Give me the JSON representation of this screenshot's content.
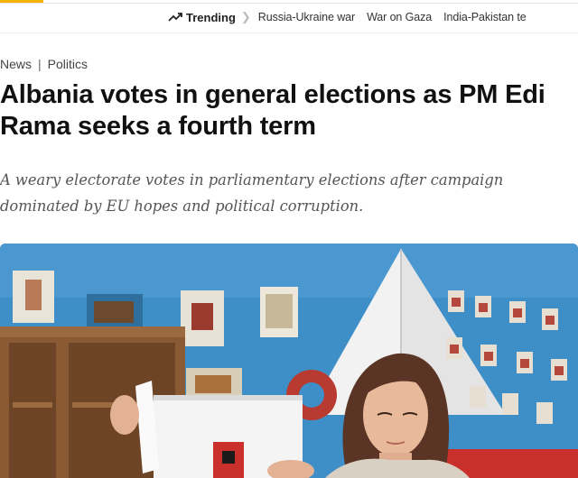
{
  "trending": {
    "label": "Trending",
    "links": [
      "Russia-Ukraine war",
      "War on Gaza",
      "India-Pakistan te"
    ]
  },
  "article": {
    "breadcrumb": [
      "News",
      "Politics"
    ],
    "breadcrumb_separator": "|",
    "headline": "Albania votes in general elections as PM Edi Rama seeks a fourth term",
    "standfirst": "A weary electorate votes in parliamentary elections after campaign dominated by EU hopes and political corruption."
  },
  "icons": {
    "trending": "trending-up-icon",
    "separator": "chevron-right-icon"
  },
  "colors": {
    "accent": "#f2b400",
    "wall_blue": "#3e8fc7"
  }
}
